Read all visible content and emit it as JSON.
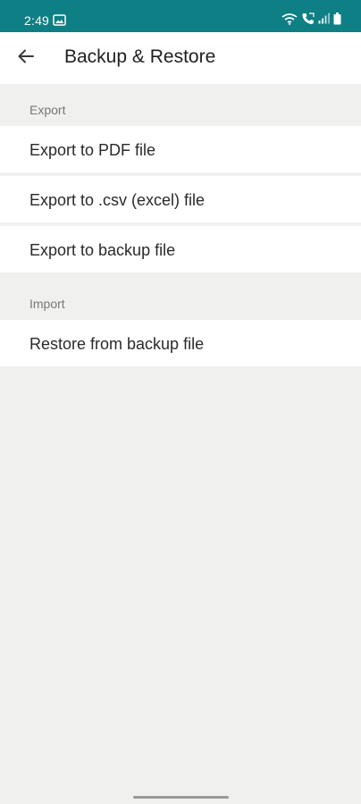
{
  "status_bar": {
    "time": "2:49",
    "background": "#0e7f84",
    "icons": [
      "gallery-icon",
      "wifi-icon",
      "call-icon",
      "signal-icon",
      "battery-icon"
    ]
  },
  "header": {
    "back_icon": "arrow-left-icon",
    "title": "Backup & Restore"
  },
  "sections": [
    {
      "title": "Export",
      "items": [
        {
          "label": "Export to PDF file"
        },
        {
          "label": "Export to .csv (excel) file"
        },
        {
          "label": "Export to backup file"
        }
      ]
    },
    {
      "title": "Import",
      "items": [
        {
          "label": "Restore from backup file"
        }
      ]
    }
  ]
}
